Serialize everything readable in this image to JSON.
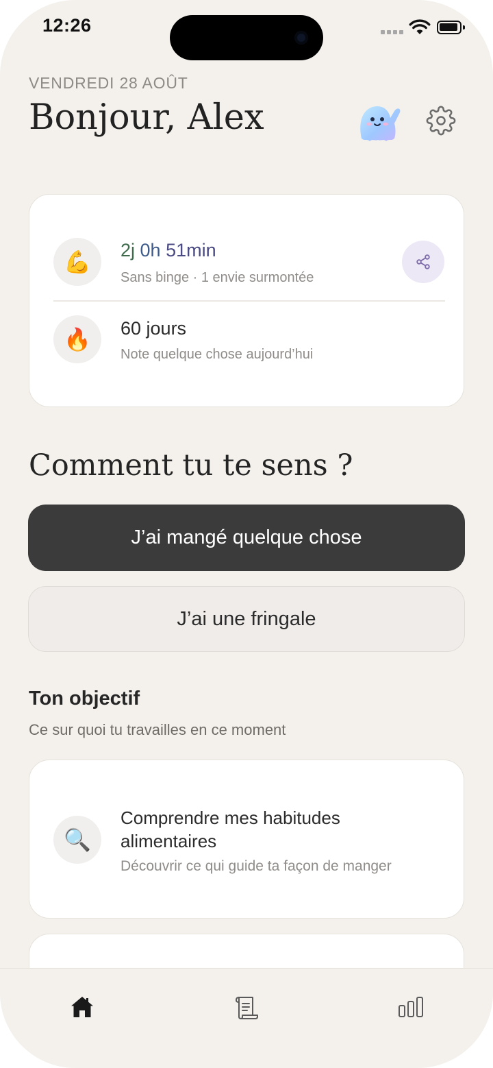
{
  "status_bar": {
    "time": "12:26"
  },
  "header": {
    "date": "VENDREDI 28 AOÛT",
    "greeting": "Bonjour, Alex",
    "mascot_icon": "ghost-mascot-icon",
    "settings_icon": "gear-icon"
  },
  "streak_card": {
    "abstinence": {
      "icon": "💪",
      "days": "2j",
      "hours": "0h",
      "minutes": "51min",
      "subtitle": "Sans binge · 1 envie surmontée",
      "share_icon": "share-icon"
    },
    "journal": {
      "icon": "🔥",
      "title": "60 jours",
      "subtitle": "Note quelque chose aujourd’hui"
    }
  },
  "mood": {
    "title": "Comment tu te sens ?",
    "primary_button": "J’ai mangé quelque chose",
    "secondary_button": "J’ai une fringale"
  },
  "goal": {
    "heading": "Ton objectif",
    "subheading": "Ce sur quoi tu travailles en ce moment",
    "card": {
      "icon": "🔍",
      "title_line1": "Comprendre mes habitudes",
      "title_line2": "alimentaires",
      "description": "Découvrir ce qui guide ta façon de manger"
    }
  },
  "tabbar": {
    "tabs": [
      {
        "icon": "home-icon",
        "active": true
      },
      {
        "icon": "journal-scroll-icon",
        "active": false
      },
      {
        "icon": "stats-bars-icon",
        "active": false
      }
    ]
  },
  "colors": {
    "background": "#f4f1ec",
    "primary_button": "#3b3b3b",
    "secondary_button": "#f0ecea",
    "days_text": "#3d6b4c",
    "hours_text": "#3d5a8a",
    "minutes_text": "#4a4a84",
    "share_bg": "#ece8f6"
  }
}
